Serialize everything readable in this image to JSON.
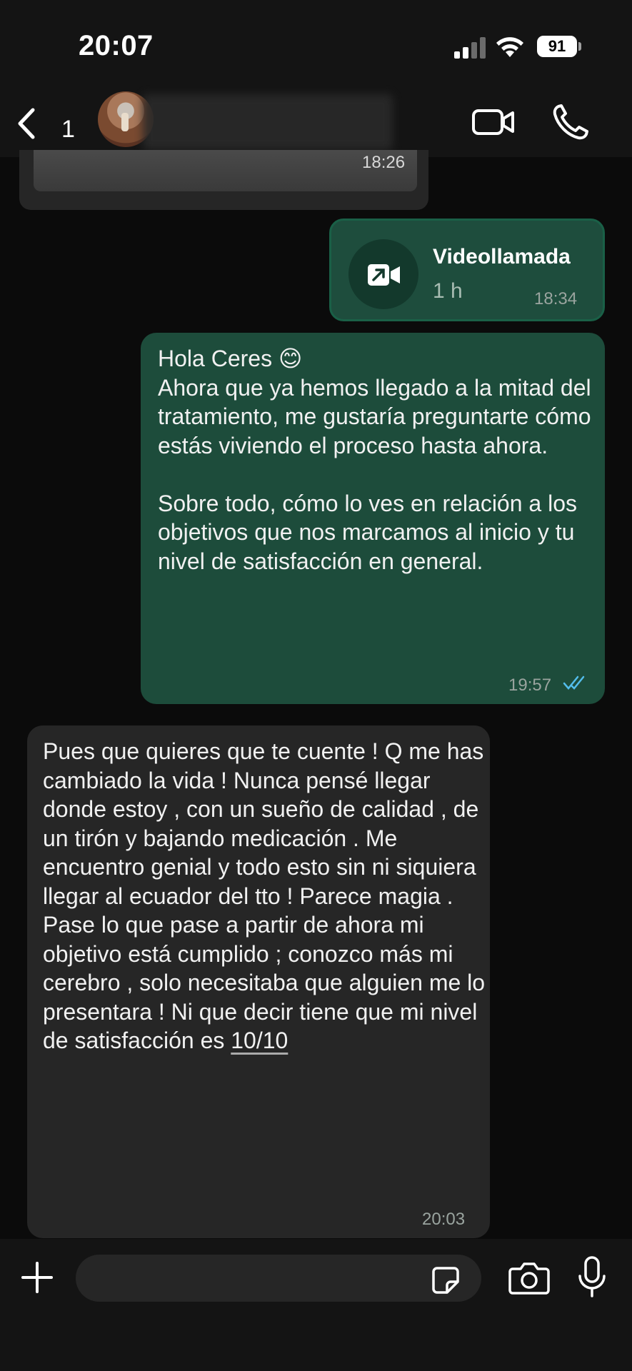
{
  "status_bar": {
    "time": "20:07",
    "battery": "91"
  },
  "header": {
    "back_count": "1",
    "contact_name": ""
  },
  "messages": {
    "previous_media": {
      "time": "18:26"
    },
    "video_call": {
      "title": "Videollamada",
      "duration": "1 h",
      "time": "18:34"
    },
    "outgoing": {
      "text": "Hola Ceres 😊\nAhora que ya hemos llegado a la mitad del tratamiento, me gustaría preguntarte cómo estás viviendo el proceso hasta ahora.\n\nSobre todo, cómo lo ves en relación a los objetivos que nos marcamos al inicio y tu nivel de satisfacción en general.",
      "time": "19:57",
      "status": "read"
    },
    "incoming": {
      "text": "Pues que quieres que te cuente ! Q me has cambiado la vida ! Nunca pensé llegar donde estoy , con un sueño de calidad , de un tirón y bajando medicación . Me encuentro genial y todo esto sin ni siquiera llegar al ecuador del tto ! Parece magia . Pase lo que pase a partir de ahora mi objetivo está cumplido ; conozco más mi cerebro , solo necesitaba que alguien me lo presentara ! Ni que decir tiene que mi nivel de satisfacción es ",
      "highlight": "10/10",
      "time": "20:03"
    }
  },
  "input": {
    "value": "",
    "placeholder": ""
  },
  "colors": {
    "outgoing_bubble": "#1d4c3b",
    "incoming_bubble": "#262626",
    "read_ticks": "#53bdeb",
    "background": "#0b0b0b"
  },
  "icons": [
    "signal-icon",
    "wifi-icon",
    "battery-icon",
    "chevron-left-icon",
    "video-camera-icon",
    "phone-icon",
    "video-call-arrow-icon",
    "double-check-icon",
    "chevron-down-icon",
    "plus-icon",
    "sticker-icon",
    "camera-icon",
    "microphone-icon"
  ]
}
